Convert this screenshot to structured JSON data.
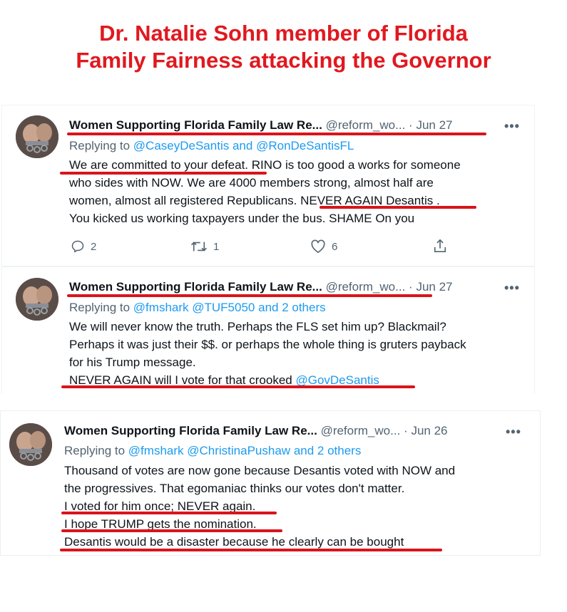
{
  "headline": {
    "line1": "Dr. Natalie Sohn member of Florida",
    "line2": "Family Fairness attacking the Governor"
  },
  "colors": {
    "headline": "#e0191f",
    "underline": "#d9141b",
    "link": "#1d9bf0",
    "secondary_text": "#536471"
  },
  "tweets": [
    {
      "author": "Women Supporting Florida Family Law Re...",
      "handle": "@reform_wo...",
      "separator": "·",
      "date": "Jun 27",
      "more": "•••",
      "replying_to": "Replying to",
      "mention1": "@CaseyDeSantis",
      "and": "and",
      "mention2": "@RonDeSantisFL",
      "lines": [
        "We are committed to your defeat. RINO is too good a works for someone",
        "who sides with NOW. We are 4000 members strong, almost half are",
        "women, almost all registered Republicans. NEVER AGAIN Desantis .",
        "You kicked us working taxpayers under the bus. SHAME On you"
      ],
      "actions": {
        "replies": "2",
        "retweets": "1",
        "likes": "6"
      },
      "icons": [
        "reply-icon",
        "retweet-icon",
        "like-icon",
        "share-icon"
      ]
    },
    {
      "author": "Women Supporting Florida Family Law Re...",
      "handle": "@reform_wo...",
      "separator": "·",
      "date": "Jun 27",
      "more": "•••",
      "replying_to": "Replying to",
      "mention1": "@fmshark",
      "mention2": "@TUF5050",
      "and_others": "and 2 others",
      "lines": [
        "We will never know the truth. Perhaps the FLS set him up? Blackmail?",
        "Perhaps it was just their $$. or perhaps the whole thing is gruters payback",
        "for his Trump message."
      ],
      "last_line_text": "NEVER AGAIN will I vote for that crooked ",
      "last_line_mention": "@GovDeSantis"
    },
    {
      "author": "Women Supporting Florida Family Law Re...",
      "handle": "@reform_wo...",
      "separator": "·",
      "date": "Jun 26",
      "more": "•••",
      "replying_to": "Replying to",
      "mention1": "@fmshark",
      "mention2": "@ChristinaPushaw",
      "and_others": "and 2 others",
      "lines": [
        "Thousand of votes are now gone because Desantis voted with NOW and",
        "the progressives.  That egomaniac thinks our votes don't matter.",
        "I voted for him once; NEVER again.",
        "I hope TRUMP gets the nomination.",
        "Desantis would be a disaster because he clearly can be bought"
      ]
    }
  ]
}
